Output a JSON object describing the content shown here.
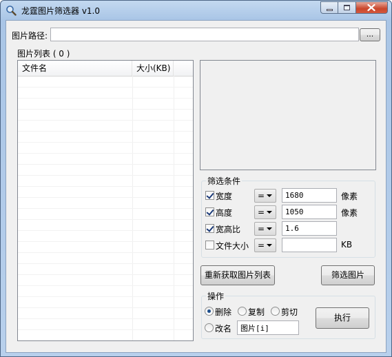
{
  "window": {
    "title": "龙霆图片筛选器 v1.0",
    "icon": "magnifier-icon"
  },
  "path": {
    "label": "图片路径",
    "colon": ":",
    "value": "",
    "browse_label": "..."
  },
  "image_list": {
    "title": "图片列表 ( 0 )",
    "columns": [
      "文件名",
      "大小(KB)"
    ]
  },
  "filter": {
    "title": "筛选条件",
    "rows": [
      {
        "label": "宽度",
        "checked": true,
        "op": "=",
        "value": "1680",
        "unit": "像素"
      },
      {
        "label": "高度",
        "checked": true,
        "op": "=",
        "value": "1050",
        "unit": "像素"
      },
      {
        "label": "宽高比",
        "checked": true,
        "op": "=",
        "value": "1.6",
        "unit": ""
      },
      {
        "label": "文件大小",
        "checked": false,
        "op": "=",
        "value": "",
        "unit": "KB"
      }
    ]
  },
  "buttons": {
    "reload": "重新获取图片列表",
    "filter": "筛选图片",
    "execute": "执行"
  },
  "operation": {
    "title": "操作",
    "options": [
      {
        "label": "删除",
        "selected": true
      },
      {
        "label": "复制",
        "selected": false
      },
      {
        "label": "剪切",
        "selected": false
      },
      {
        "label": "改名",
        "selected": false
      }
    ],
    "rename_value": "图片[i]"
  },
  "colors": {
    "title_bar": "#b9d1ea",
    "close_button": "#c9462c",
    "client_bg": "#f0f0f0"
  }
}
